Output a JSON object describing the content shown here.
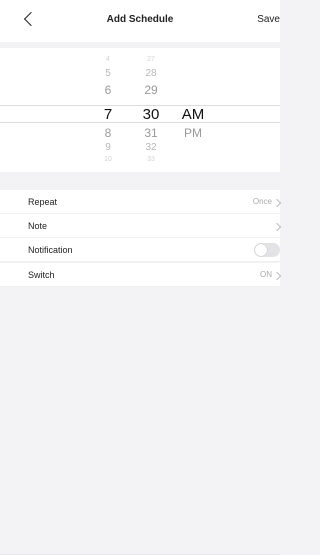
{
  "nav": {
    "title": "Add Schedule",
    "save_label": "Save"
  },
  "picker": {
    "hours": [
      "4",
      "5",
      "6",
      "7",
      "8",
      "9",
      "10"
    ],
    "minutes": [
      "27",
      "28",
      "29",
      "30",
      "31",
      "32",
      "33"
    ],
    "ampm": [
      "AM",
      "PM"
    ],
    "selected": {
      "hour": "7",
      "minute": "30",
      "ampm": "AM"
    }
  },
  "settings": {
    "repeat": {
      "label": "Repeat",
      "value": "Once"
    },
    "note": {
      "label": "Note"
    },
    "notification": {
      "label": "Notification",
      "enabled": false
    }
  },
  "switch_row": {
    "label": "Switch",
    "value": "ON"
  }
}
